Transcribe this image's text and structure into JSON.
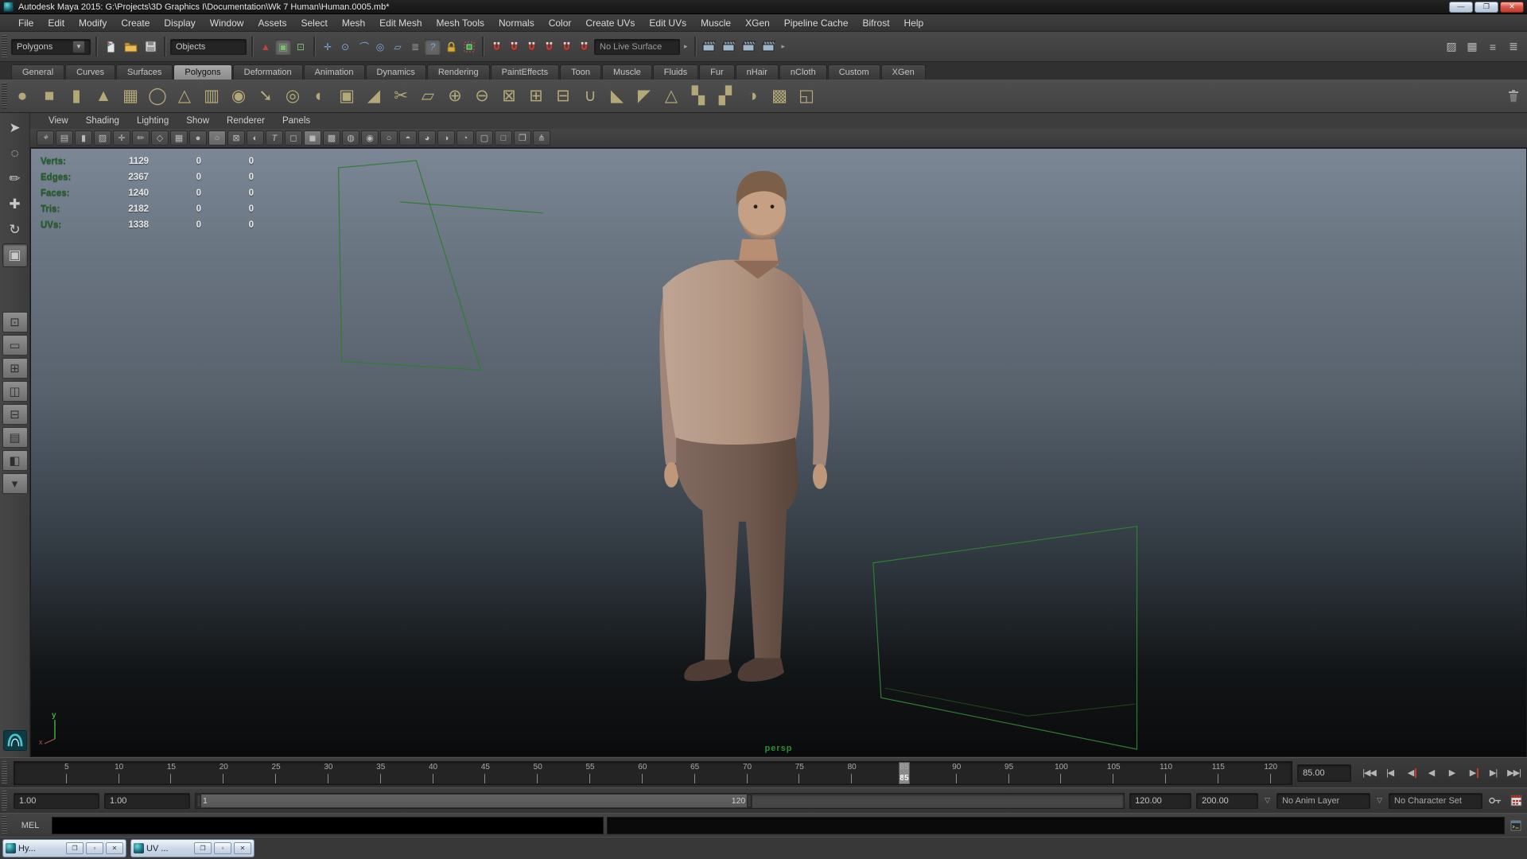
{
  "window": {
    "title": "Autodesk Maya 2015: G:\\Projects\\3D Graphics I\\Documentation\\Wk 7 Human\\Human.0005.mb*",
    "controls": [
      {
        "name": "minimize-button",
        "cls": "wc-min"
      },
      {
        "name": "restore-button",
        "cls": "wc-res"
      },
      {
        "name": "close-button",
        "cls": "wc-close close"
      }
    ]
  },
  "menubar": [
    {
      "name": "menu-file",
      "label": "File"
    },
    {
      "name": "menu-edit",
      "label": "Edit"
    },
    {
      "name": "menu-modify",
      "label": "Modify"
    },
    {
      "name": "menu-create",
      "label": "Create"
    },
    {
      "name": "menu-display",
      "label": "Display"
    },
    {
      "name": "menu-window",
      "label": "Window"
    },
    {
      "name": "menu-assets",
      "label": "Assets"
    },
    {
      "name": "menu-select",
      "label": "Select"
    },
    {
      "name": "menu-mesh",
      "label": "Mesh"
    },
    {
      "name": "menu-edit-mesh",
      "label": "Edit Mesh"
    },
    {
      "name": "menu-mesh-tools",
      "label": "Mesh Tools"
    },
    {
      "name": "menu-normals",
      "label": "Normals"
    },
    {
      "name": "menu-color",
      "label": "Color"
    },
    {
      "name": "menu-create-uvs",
      "label": "Create UVs"
    },
    {
      "name": "menu-edit-uvs",
      "label": "Edit UVs"
    },
    {
      "name": "menu-muscle",
      "label": "Muscle"
    },
    {
      "name": "menu-xgen",
      "label": "XGen"
    },
    {
      "name": "menu-pipeline-cache",
      "label": "Pipeline Cache"
    },
    {
      "name": "menu-bifrost",
      "label": "Bifrost"
    },
    {
      "name": "menu-help",
      "label": "Help"
    }
  ],
  "statusline": {
    "mode_selector": "Polygons",
    "selection_mask": "Objects",
    "live_surface": "No Live Surface",
    "selection_modes": [
      {
        "name": "select-hierarchy-icon",
        "g": "▲",
        "cls": "c-red"
      },
      {
        "name": "select-object-icon",
        "g": "▣",
        "cls": "c-green",
        "active": true
      },
      {
        "name": "select-component-icon",
        "g": "⊡",
        "cls": "c-green"
      }
    ],
    "snap_icons": [
      {
        "name": "snap-to-grid-icon",
        "g": "✛",
        "cls": "c-blue"
      },
      {
        "name": "snap-to-point-icon",
        "g": "⊙",
        "cls": "c-blue"
      },
      {
        "name": "snap-to-curve-icon",
        "g": "⌒",
        "cls": "c-blue"
      },
      {
        "name": "snap-projected-center-icon",
        "g": "◎",
        "cls": "c-blue"
      },
      {
        "name": "snap-view-plane-icon",
        "g": "▱",
        "cls": "c-blue"
      },
      {
        "name": "construction-history-icon",
        "g": "≣",
        "cls": "c-gray"
      },
      {
        "name": "help-icon",
        "g": "?",
        "cls": "c-blue",
        "active": true
      }
    ],
    "magnets": [
      {
        "name": "snap-magnet-grid-icon"
      },
      {
        "name": "snap-magnet-curve-icon"
      },
      {
        "name": "snap-magnet-point-icon"
      },
      {
        "name": "snap-magnet-center-icon"
      },
      {
        "name": "snap-magnet-plane-icon"
      },
      {
        "name": "make-live-magnet-icon"
      }
    ],
    "render_icons": [
      {
        "name": "open-render-view-icon"
      },
      {
        "name": "render-current-frame-icon"
      },
      {
        "name": "ipr-render-icon"
      },
      {
        "name": "render-settings-icon"
      }
    ],
    "sidebar_toggles": [
      {
        "name": "modeling-toolkit-toggle-icon",
        "g": "▨"
      },
      {
        "name": "attribute-editor-toggle-icon",
        "g": "▦"
      },
      {
        "name": "tool-settings-toggle-icon",
        "g": "≡"
      },
      {
        "name": "channel-box-toggle-icon",
        "g": "≣"
      }
    ]
  },
  "shelf": {
    "tabs": [
      {
        "name": "shelf-tab-general",
        "label": "General"
      },
      {
        "name": "shelf-tab-curves",
        "label": "Curves"
      },
      {
        "name": "shelf-tab-surfaces",
        "label": "Surfaces"
      },
      {
        "name": "shelf-tab-polygons",
        "label": "Polygons",
        "active": true
      },
      {
        "name": "shelf-tab-deformation",
        "label": "Deformation"
      },
      {
        "name": "shelf-tab-animation",
        "label": "Animation"
      },
      {
        "name": "shelf-tab-dynamics",
        "label": "Dynamics"
      },
      {
        "name": "shelf-tab-rendering",
        "label": "Rendering"
      },
      {
        "name": "shelf-tab-painteffects",
        "label": "PaintEffects"
      },
      {
        "name": "shelf-tab-toon",
        "label": "Toon"
      },
      {
        "name": "shelf-tab-muscle",
        "label": "Muscle"
      },
      {
        "name": "shelf-tab-fluids",
        "label": "Fluids"
      },
      {
        "name": "shelf-tab-fur",
        "label": "Fur"
      },
      {
        "name": "shelf-tab-nhair",
        "label": "nHair"
      },
      {
        "name": "shelf-tab-ncloth",
        "label": "nCloth"
      },
      {
        "name": "shelf-tab-custom",
        "label": "Custom"
      },
      {
        "name": "shelf-tab-xgen",
        "label": "XGen"
      }
    ],
    "icons": [
      {
        "name": "poly-sphere-icon",
        "g": "●"
      },
      {
        "name": "poly-cube-icon",
        "g": "■"
      },
      {
        "name": "poly-cylinder-icon",
        "g": "▮"
      },
      {
        "name": "poly-cone-icon",
        "g": "▲"
      },
      {
        "name": "poly-plane-icon",
        "g": "▦"
      },
      {
        "name": "poly-torus-icon",
        "g": "◯"
      },
      {
        "name": "poly-pyramid-icon",
        "g": "△"
      },
      {
        "name": "poly-pipe-icon",
        "g": "▥"
      },
      {
        "name": "sculpt-geometry-icon",
        "g": "◉"
      },
      {
        "name": "quad-draw-icon",
        "g": "➘",
        "cls": "c-red"
      },
      {
        "name": "smooth-icon",
        "g": "◎"
      },
      {
        "name": "smooth-mesh-preview-icon",
        "g": "◐"
      },
      {
        "name": "subdiv-proxy-icon",
        "g": "▣",
        "cls": "c-magenta"
      },
      {
        "name": "reduce-icon",
        "g": "◢"
      },
      {
        "name": "multi-cut-icon",
        "g": "✂",
        "cls": "c-green"
      },
      {
        "name": "extract-icon",
        "g": "▱"
      },
      {
        "name": "combine-icon",
        "g": "⊕"
      },
      {
        "name": "separate-icon",
        "g": "⊖"
      },
      {
        "name": "fill-hole-icon",
        "g": "⊠"
      },
      {
        "name": "append-polygon-icon",
        "g": "⊞"
      },
      {
        "name": "split-mesh-icon",
        "g": "⊟"
      },
      {
        "name": "merge-vertices-icon",
        "g": "∪"
      },
      {
        "name": "bevel-icon",
        "g": "◣"
      },
      {
        "name": "bridge-icon",
        "g": "◤"
      },
      {
        "name": "spin-edge-icon",
        "g": "△",
        "cls": "c-blue"
      },
      {
        "name": "uv-planar-mapping-icon",
        "g": "▚",
        "cls": "c-white"
      },
      {
        "name": "uv-cylindrical-mapping-icon",
        "g": "▞",
        "cls": "c-white"
      },
      {
        "name": "uv-spherical-mapping-icon",
        "g": "◑",
        "cls": "c-white"
      },
      {
        "name": "uv-automatic-mapping-icon",
        "g": "▩",
        "cls": "c-white"
      },
      {
        "name": "uv-editor-icon",
        "g": "◱",
        "cls": "c-white"
      }
    ]
  },
  "toolbox": {
    "tools": [
      {
        "name": "select-tool-button",
        "g": "➤",
        "cls": "c-red"
      },
      {
        "name": "lasso-tool-button",
        "g": "◌",
        "cls": "c-white"
      },
      {
        "name": "paint-select-tool-button",
        "g": "✏",
        "cls": "c-red"
      },
      {
        "name": "move-tool-button",
        "g": "✚",
        "cls": "c-blue"
      },
      {
        "name": "rotate-tool-button",
        "g": "↻",
        "cls": "c-blue"
      },
      {
        "name": "scale-tool-button",
        "g": "▣",
        "cls": "c-blue",
        "active": true
      }
    ],
    "layouts": [
      {
        "name": "universal-manipulator-icon",
        "g": "⊡",
        "cls": "c-red"
      },
      {
        "name": "layout-single-pane-button",
        "g": "▭"
      },
      {
        "name": "layout-four-pane-button",
        "g": "⊞"
      },
      {
        "name": "layout-persp-outliner-button",
        "g": "◫"
      },
      {
        "name": "layout-persp-graph-button",
        "g": "⊟"
      },
      {
        "name": "layout-hypergraph-persp-button",
        "g": "▤"
      },
      {
        "name": "layout-persp-outliner-graph-button",
        "g": "◧"
      },
      {
        "name": "layout-more-button",
        "g": "▾"
      }
    ]
  },
  "panel": {
    "menus": [
      {
        "name": "panel-menu-view",
        "label": "View"
      },
      {
        "name": "panel-menu-shading",
        "label": "Shading"
      },
      {
        "name": "panel-menu-lighting",
        "label": "Lighting"
      },
      {
        "name": "panel-menu-show",
        "label": "Show"
      },
      {
        "name": "panel-menu-renderer",
        "label": "Renderer"
      },
      {
        "name": "panel-menu-panels",
        "label": "Panels"
      }
    ],
    "icons": [
      {
        "name": "select-camera-icon",
        "g": "⌖"
      },
      {
        "name": "camera-attributes-icon",
        "g": "▤"
      },
      {
        "name": "bookmark-icon",
        "g": "▮",
        "cls": "c-green"
      },
      {
        "name": "image-plane-icon",
        "g": "▨"
      },
      {
        "name": "pan-zoom-icon",
        "g": "✛",
        "cls": "c-red"
      },
      {
        "name": "grease-pencil-icon",
        "g": "✏",
        "cls": "c-red"
      },
      {
        "name": "wireframe-icon",
        "g": "◇"
      },
      {
        "name": "smooth-shade-icon",
        "g": "▦"
      },
      {
        "name": "shaded-icon",
        "g": "●",
        "cls": "c-blue"
      },
      {
        "name": "flat-shade-icon",
        "g": "○",
        "active": true
      },
      {
        "name": "bounding-box-icon",
        "g": "⊠"
      },
      {
        "name": "textured-icon",
        "g": "◐",
        "cls": "c-green"
      },
      {
        "name": "use-default-material-icon",
        "g": "T",
        "cls": "c-green"
      },
      {
        "name": "wire-on-shaded-icon",
        "g": "◻"
      },
      {
        "name": "xray-icon",
        "g": "◼",
        "cls": "c-blue",
        "active": true
      },
      {
        "name": "xray-joints-icon",
        "g": "▩",
        "cls": "c-green"
      },
      {
        "name": "hardware-texturing-icon",
        "g": "◍",
        "cls": "c-blue"
      },
      {
        "name": "default-lighting-icon",
        "g": "◉",
        "cls": "c-yellow"
      },
      {
        "name": "all-lights-icon",
        "g": "○"
      },
      {
        "name": "shadows-icon",
        "g": "◓"
      },
      {
        "name": "ao-icon",
        "g": "◕",
        "cls": "c-yellow"
      },
      {
        "name": "motion-blur-icon",
        "g": "◑"
      },
      {
        "name": "dof-icon",
        "g": "◔",
        "cls": "c-blue"
      },
      {
        "name": "isolate-select-icon",
        "g": "▢",
        "cls": "c-green"
      },
      {
        "name": "plugin-shapes-icon",
        "g": "□"
      },
      {
        "name": "plugin-locators-icon",
        "g": "❐"
      },
      {
        "name": "node-links-icon",
        "g": "⋔"
      }
    ],
    "hud": [
      {
        "label": "Verts:",
        "v1": "1129",
        "v2": "0",
        "v3": "0"
      },
      {
        "label": "Edges:",
        "v1": "2367",
        "v2": "0",
        "v3": "0"
      },
      {
        "label": "Faces:",
        "v1": "1240",
        "v2": "0",
        "v3": "0"
      },
      {
        "label": "Tris:",
        "v1": "2182",
        "v2": "0",
        "v3": "0"
      },
      {
        "label": "UVs:",
        "v1": "1338",
        "v2": "0",
        "v3": "0"
      }
    ],
    "camera_label": "persp"
  },
  "timeslider": {
    "ticks": [
      5,
      10,
      15,
      20,
      25,
      30,
      35,
      40,
      45,
      50,
      55,
      60,
      65,
      70,
      75,
      80,
      85,
      90,
      95,
      100,
      105,
      110,
      115,
      120
    ],
    "current_frame": 85,
    "current_frame_label": "85",
    "current_time": "85.00",
    "playback": [
      {
        "name": "go-to-start-button",
        "g": "|◀◀"
      },
      {
        "name": "step-back-frame-button",
        "g": "|◀"
      },
      {
        "name": "step-back-key-button",
        "g": "◀",
        "red": true
      },
      {
        "name": "play-backwards-button",
        "g": "◀"
      },
      {
        "name": "play-forwards-button",
        "g": "▶"
      },
      {
        "name": "step-forward-key-button",
        "g": "▶",
        "red": true
      },
      {
        "name": "step-forward-frame-button",
        "g": "▶|"
      },
      {
        "name": "go-to-end-button",
        "g": "▶▶|"
      }
    ]
  },
  "rangeslider": {
    "anim_start": "1.00",
    "play_start": "1.00",
    "bar_start_label": "1",
    "bar_end_label": "120",
    "play_end": "120.00",
    "anim_end": "200.00",
    "anim_layer": "No Anim Layer",
    "character_set": "No Character Set"
  },
  "commandline": {
    "label": "MEL"
  },
  "taskbar": {
    "windows": [
      {
        "title": "Hy..."
      },
      {
        "title": "UV ..."
      }
    ]
  }
}
